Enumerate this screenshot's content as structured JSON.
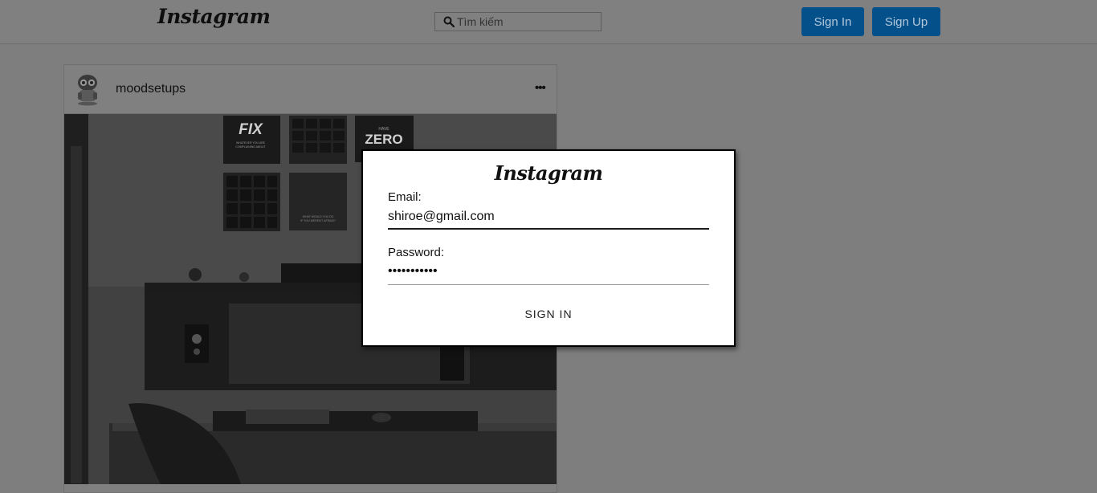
{
  "header": {
    "logo_text": "Instagram",
    "search_placeholder": "Tìm kiếm",
    "sign_in_label": "Sign In",
    "sign_up_label": "Sign Up"
  },
  "post": {
    "username": "moodsetups",
    "more_label": "•••",
    "image_texts": {
      "fix": "FIX",
      "fix_sub1": "WHATEVER YOU ARE",
      "fix_sub2": "COMPLAINING ABOUT",
      "zero_top": "HAVE",
      "zero": "ZERO",
      "quote1": "WHAT WOULD YOU DO",
      "quote2": "IF YOU WEREN'T AFRAID?"
    }
  },
  "login_modal": {
    "logo_text": "Instagram",
    "email_label": "Email:",
    "email_value": "shiroe@gmail.com",
    "password_label": "Password:",
    "password_value": "abcdefghijk",
    "submit_label": "SIGN IN"
  },
  "colors": {
    "overlay": "#7e7e7e",
    "button_dim": "#04508a",
    "modal_bg": "#ffffff"
  }
}
